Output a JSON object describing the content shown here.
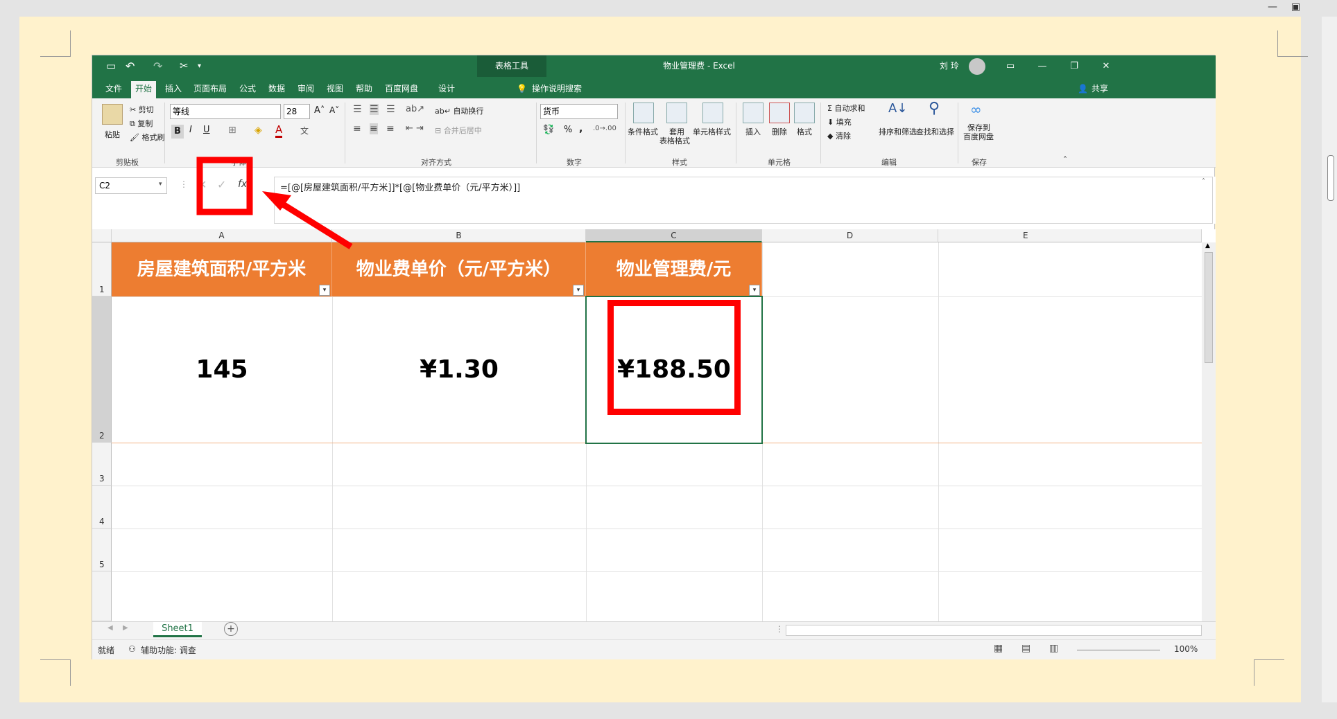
{
  "excel": {
    "qat": {
      "save_icon": "save-icon",
      "undo_icon": "undo-icon",
      "redo_icon": "redo-icon",
      "cut_icon": "cut-icon"
    },
    "context_group": "表格工具",
    "title": "物业管理费 - Excel",
    "user_name": "刘 玲",
    "tabs": [
      "文件",
      "开始",
      "插入",
      "页面布局",
      "公式",
      "数据",
      "审阅",
      "视图",
      "帮助",
      "百度网盘",
      "设计"
    ],
    "active_tab": "开始",
    "tell_me": "操作说明搜索",
    "share": "共享",
    "ribbon": {
      "clipboard": {
        "paste": "粘贴",
        "cut": "剪切",
        "copy": "复制",
        "format_painter": "格式刷",
        "label": "剪贴板"
      },
      "font": {
        "name": "等线",
        "size": "28",
        "label": "字体",
        "bold": "B",
        "italic": "I",
        "underline": "U"
      },
      "alignment": {
        "wrap": "自动换行",
        "merge": "合并后居中",
        "label": "对齐方式"
      },
      "number": {
        "format": "货币",
        "percent": "%",
        "comma": ",",
        "label": "数字"
      },
      "styles": {
        "conditional": "条件格式",
        "table_format_1": "套用",
        "table_format_2": "表格格式",
        "cell_styles": "单元格样式",
        "label": "样式"
      },
      "cells": {
        "insert": "插入",
        "delete": "删除",
        "format": "格式",
        "label": "单元格"
      },
      "editing": {
        "autosum": "自动求和",
        "fill": "填充",
        "clear": "清除",
        "sort": "排序和筛选",
        "find": "查找和选择",
        "label": "编辑"
      },
      "save": {
        "save_1": "保存到",
        "save_2": "百度网盘",
        "label": "保存"
      }
    },
    "name_box": "C2",
    "formula": "=[@[房屋建筑面积/平方米]]*[@[物业费单价（元/平方米）]]",
    "columns": [
      "A",
      "B",
      "C",
      "D",
      "E"
    ],
    "rows": [
      "1",
      "2",
      "3",
      "4",
      "5"
    ],
    "headers": [
      "房屋建筑面积/平方米",
      "物业费单价（元/平方米）",
      "物业管理费/元"
    ],
    "values": [
      "145",
      "¥1.30",
      "¥188.50"
    ],
    "sheet_name": "Sheet1",
    "status": "就绪",
    "accessibility": "辅助功能: 调查",
    "zoom": "100%"
  },
  "colors": {
    "excel_green": "#217346",
    "header_orange": "#ed7d31",
    "highlight_red": "#ff0000",
    "page_bg": "#fff2cc"
  }
}
